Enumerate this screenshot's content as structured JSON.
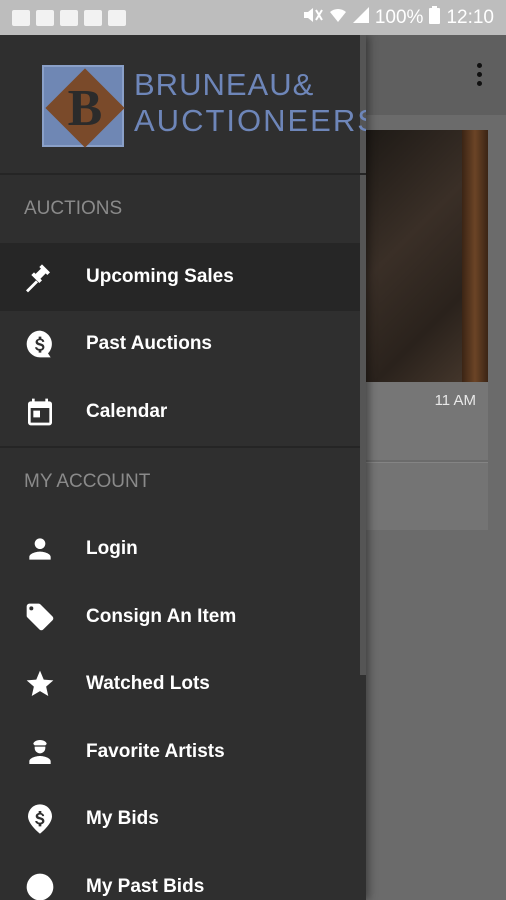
{
  "status_bar": {
    "battery": "100%",
    "time": "12:10"
  },
  "background": {
    "card_time": "11 AM"
  },
  "drawer": {
    "logo": {
      "line1": "BRUNEAU",
      "line1_suffix": "&",
      "line2": "AUCTIONEERS",
      "brand_color": "#6e86b9"
    },
    "sections": [
      {
        "title": "AUCTIONS",
        "items": [
          {
            "label": "Upcoming Sales",
            "icon": "gavel-icon",
            "active": true
          },
          {
            "label": "Past Auctions",
            "icon": "dollar-bubble-icon"
          },
          {
            "label": "Calendar",
            "icon": "calendar-icon"
          }
        ]
      },
      {
        "title": "MY ACCOUNT",
        "items": [
          {
            "label": "Login",
            "icon": "person-icon"
          },
          {
            "label": "Consign An Item",
            "icon": "tag-icon"
          },
          {
            "label": "Watched Lots",
            "icon": "star-icon"
          },
          {
            "label": "Favorite Artists",
            "icon": "artist-icon"
          },
          {
            "label": "My Bids",
            "icon": "dollar-pin-icon"
          },
          {
            "label": "My Past Bids",
            "icon": "clock-icon"
          }
        ]
      }
    ]
  }
}
